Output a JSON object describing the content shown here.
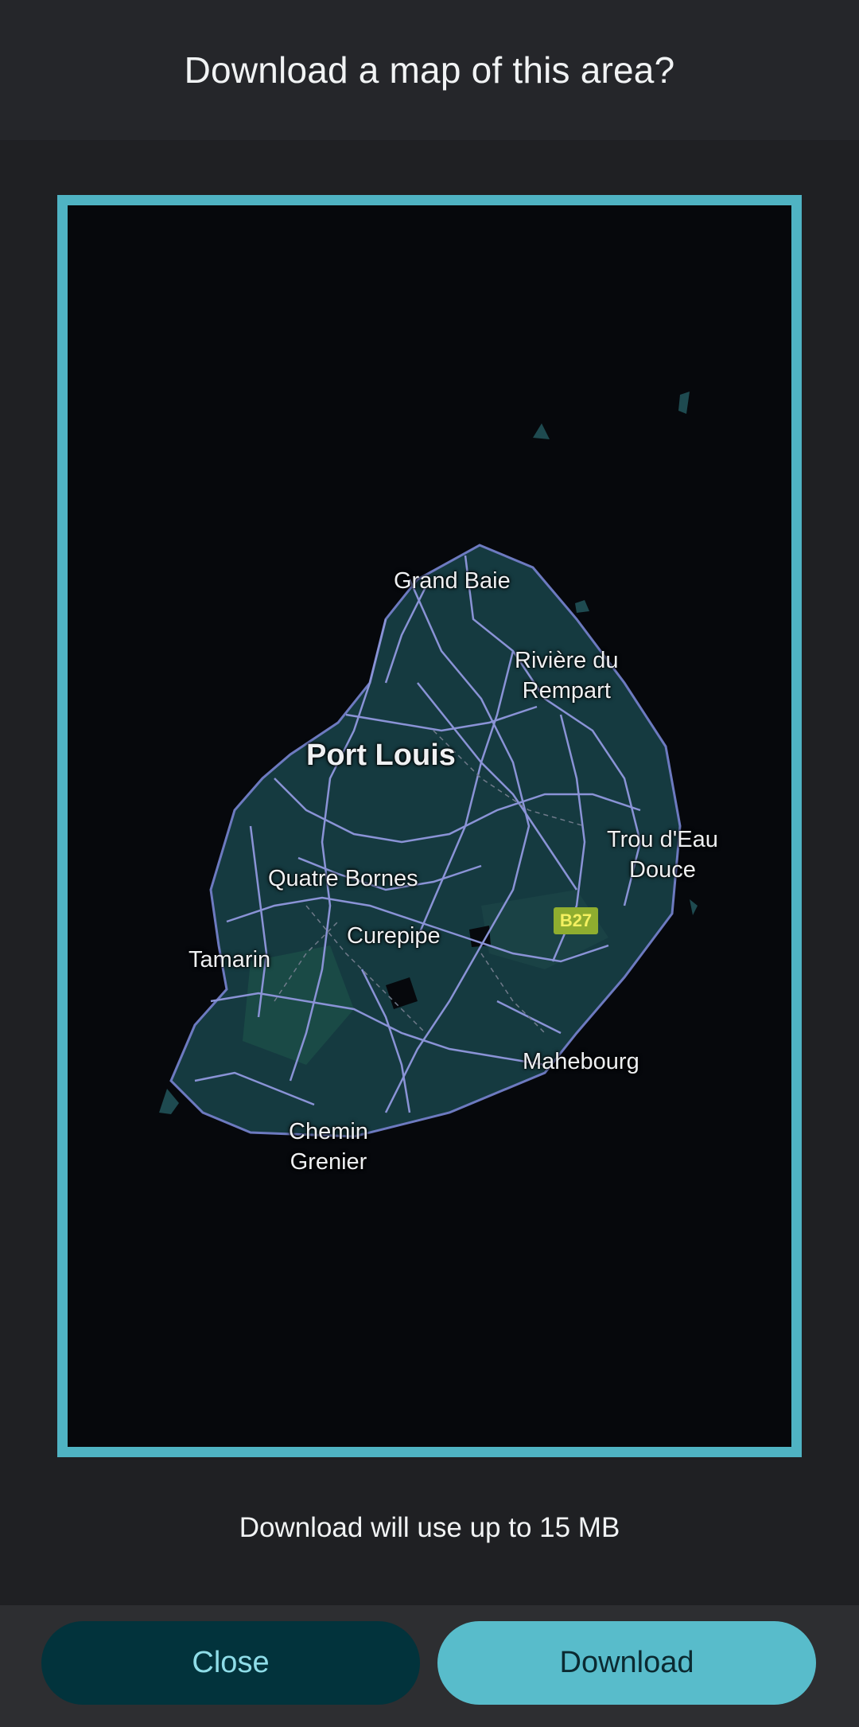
{
  "dialog": {
    "title": "Download a map of this area?"
  },
  "map": {
    "icon": "map-preview",
    "frame_color": "#4fb3c3",
    "land_color": "#153a40",
    "road_color": "#8a93d6",
    "labels": {
      "grand_baie": "Grand Baie",
      "riviere_du_rempart_1": "Rivière du",
      "riviere_du_rempart_2": "Rempart",
      "port_louis": "Port Louis",
      "trou_deau_douce_1": "Trou d'Eau",
      "trou_deau_douce_2": "Douce",
      "quatre_bornes": "Quatre Bornes",
      "curepipe": "Curepipe",
      "tamarin": "Tamarin",
      "mahebourg": "Mahebourg",
      "chemin_grenier_1": "Chemin",
      "chemin_grenier_2": "Grenier"
    },
    "road_shield": "B27"
  },
  "size_note": "Download will use up to 15 MB",
  "buttons": {
    "close": "Close",
    "download": "Download"
  }
}
